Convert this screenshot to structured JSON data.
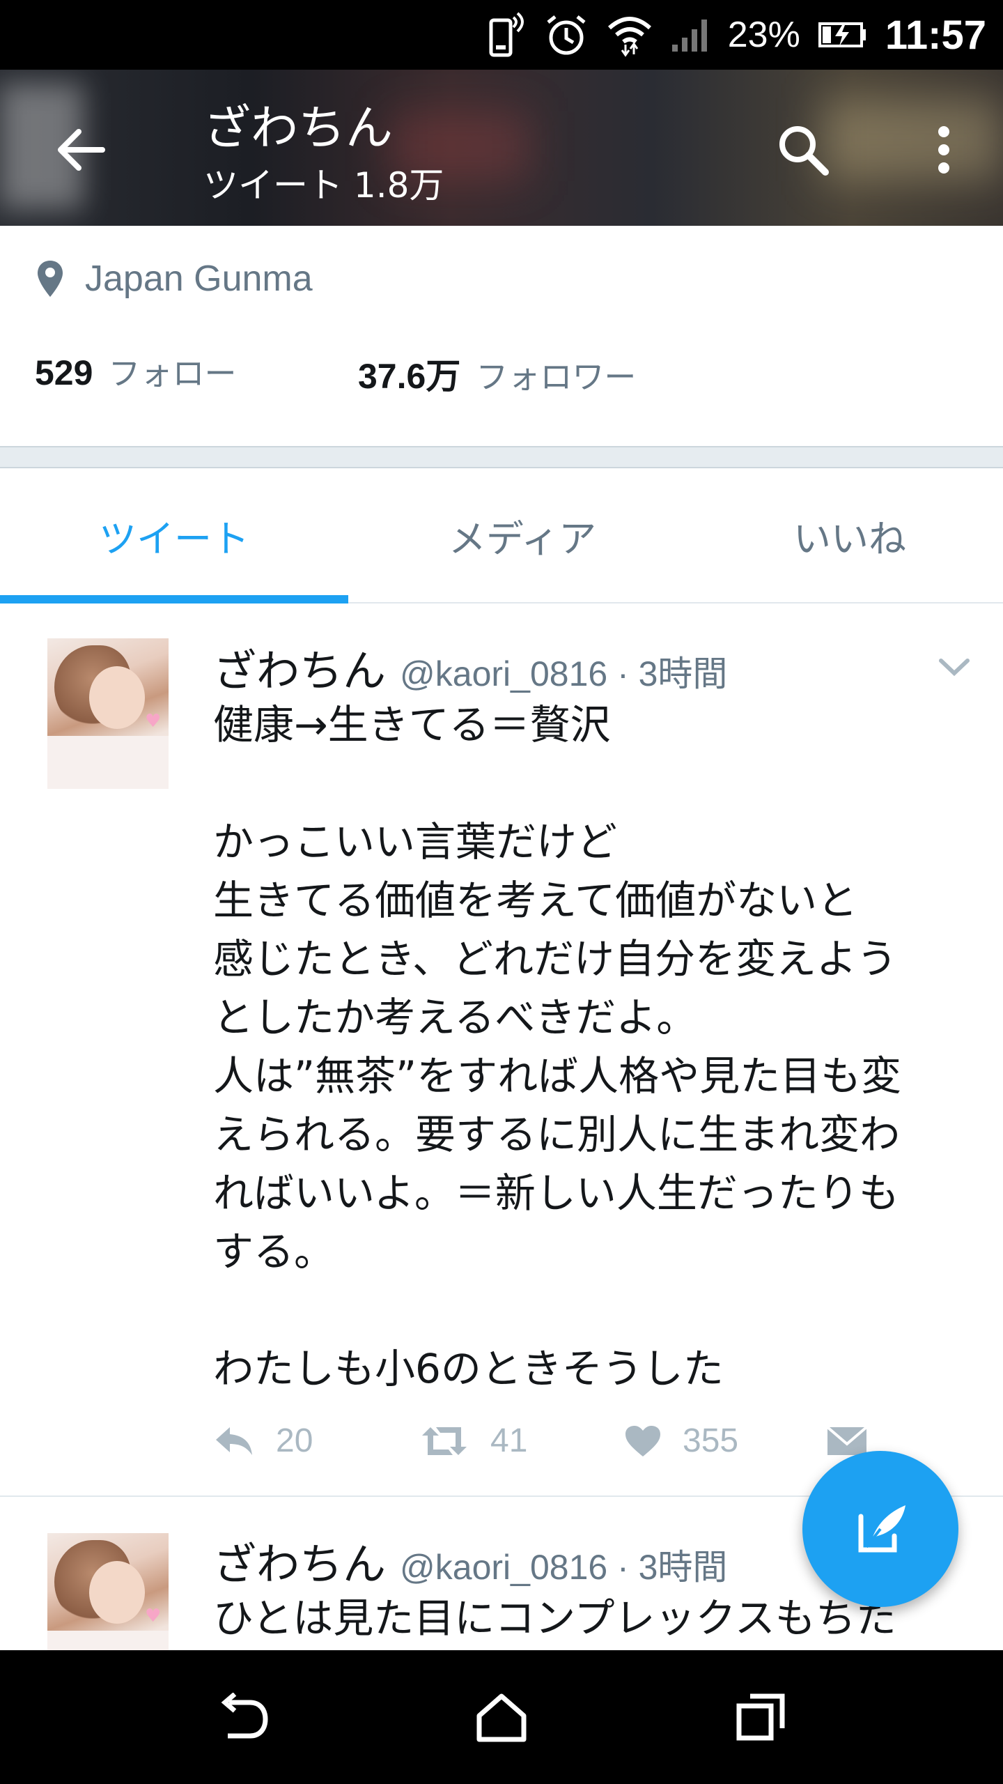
{
  "status_bar": {
    "battery_percent": "23%",
    "time": "11:57",
    "icons": [
      "vibrate-phone-icon",
      "alarm-icon",
      "wifi-icon",
      "signal-icon",
      "battery-charging-icon"
    ]
  },
  "header": {
    "title": "ざわちん",
    "tweet_count_label": "ツイート 1.8万",
    "icons": {
      "back": "arrow-left-icon",
      "search": "search-icon",
      "more": "more-vertical-icon"
    }
  },
  "profile": {
    "location": "Japan Gunma",
    "following": {
      "count": "529",
      "label": "フォロー"
    },
    "followers": {
      "count": "37.6万",
      "label": "フォロワー"
    }
  },
  "tabs": [
    {
      "label": "ツイート",
      "active": true
    },
    {
      "label": "メディア",
      "active": false
    },
    {
      "label": "いいね",
      "active": false
    }
  ],
  "tweets": [
    {
      "name": "ざわちん",
      "meta": "@kaori_0816 · 3時間",
      "lines": [
        "健康→生きてる＝贅沢",
        "",
        "かっこいい言葉だけど",
        "生きてる価値を考えて価値がないと",
        "感じたとき、どれだけ自分を変えよう",
        "としたか考えるべきだよ。",
        "人は”無茶”をすれば人格や見た目も変",
        "えられる。要するに別人に生まれ変わ",
        "ればいいよ。＝新しい人生だったりも",
        "する。",
        "",
        "わたしも小6のときそうした"
      ],
      "replies": "20",
      "retweets": "41",
      "likes": "355"
    },
    {
      "name": "ざわちん",
      "meta": "@kaori_0816 · 3時間",
      "lines": [
        "ひとは見た目にコンプレックスもちた"
      ]
    }
  ],
  "colors": {
    "accent": "#1da1f2",
    "muted": "#657786",
    "text": "#14171a"
  }
}
